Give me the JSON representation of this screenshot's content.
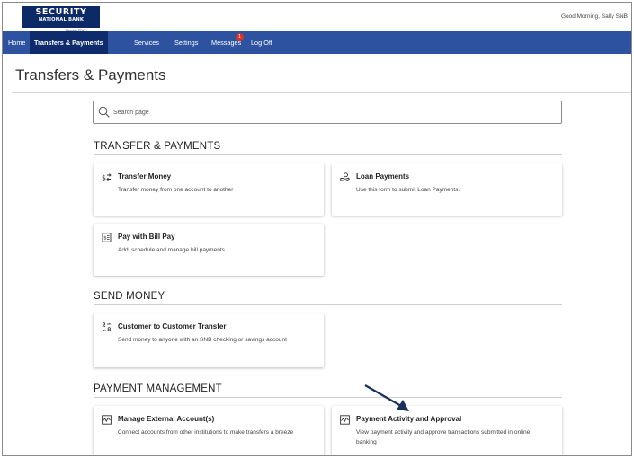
{
  "header": {
    "logo_line1": "SECURITY",
    "logo_line2": "NATIONAL BANK",
    "logo_line3": "Member FDIC",
    "greeting": "Good Morning, Sally SNB"
  },
  "nav": {
    "items": [
      "Home",
      "Transfers & Payments",
      "Services",
      "Settings",
      "Messages",
      "Log Off"
    ],
    "active": "Transfers & Payments",
    "messages_badge": "1"
  },
  "page": {
    "title": "Transfers & Payments"
  },
  "search": {
    "placeholder": "Search page"
  },
  "sections": [
    {
      "heading": "TRANSFER & PAYMENTS",
      "cards": [
        {
          "title": "Transfer Money",
          "description": "Transfer money from one account to another",
          "icon": "dollar-exchange-icon"
        },
        {
          "title": "Loan Payments",
          "description": "Use this form to submit Loan Payments.",
          "icon": "loan-payment-icon"
        },
        {
          "title": "Pay with Bill Pay",
          "description": "Add, schedule and manage bill payments",
          "icon": "bill-icon"
        }
      ]
    },
    {
      "heading": "SEND MONEY",
      "cards": [
        {
          "title": "Customer to Customer Transfer",
          "description": "Send money to anyone with an SNB checking or savings account",
          "icon": "person-transfer-icon"
        }
      ]
    },
    {
      "heading": "PAYMENT MANAGEMENT",
      "cards": [
        {
          "title": "Manage External Account(s)",
          "description": "Connect accounts from other institutions to make transfers a breeze",
          "icon": "activity-chart-icon"
        },
        {
          "title": "Payment Activity and Approval",
          "description": "View payment activity and approve transactions submitted in online banking",
          "icon": "activity-chart-icon"
        }
      ]
    }
  ],
  "colors": {
    "nav_bg": "#2d53a0",
    "nav_active_bg": "#0e2c6b",
    "logo_bg": "#0b2a66",
    "badge": "#d9322b",
    "annotation_arrow": "#1b2f5c"
  }
}
